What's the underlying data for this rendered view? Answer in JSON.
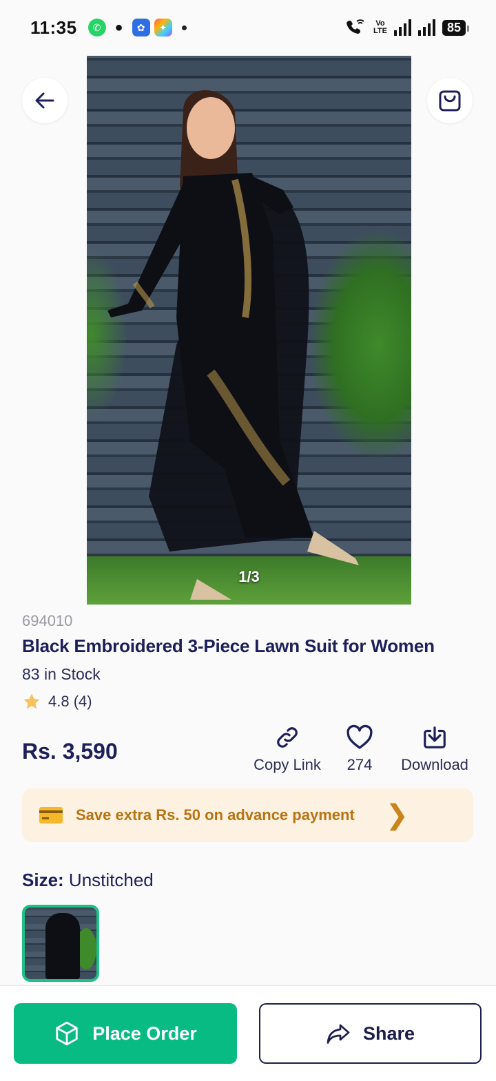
{
  "status_bar": {
    "time": "11:35",
    "volte_top": "Vo",
    "volte_bottom": "LTE",
    "battery": "85"
  },
  "product": {
    "image_counter": "1/3",
    "sku": "694010",
    "title": "Black Embroidered 3-Piece Lawn Suit for Women",
    "stock": "83 in Stock",
    "rating": "4.8 (4)",
    "price": "Rs. 3,590"
  },
  "actions": {
    "copy_link": "Copy Link",
    "likes": "274",
    "download": "Download"
  },
  "promo": {
    "text": "Save extra Rs. 50 on advance payment"
  },
  "size": {
    "label": "Size:",
    "value": "Unstitched"
  },
  "bottom": {
    "order_label": "Place Order",
    "share_label": "Share"
  },
  "colors": {
    "primary_green": "#08bb82",
    "navy": "#1c1f5a",
    "promo_bg": "#fdf1e1",
    "promo_text": "#b87412"
  }
}
